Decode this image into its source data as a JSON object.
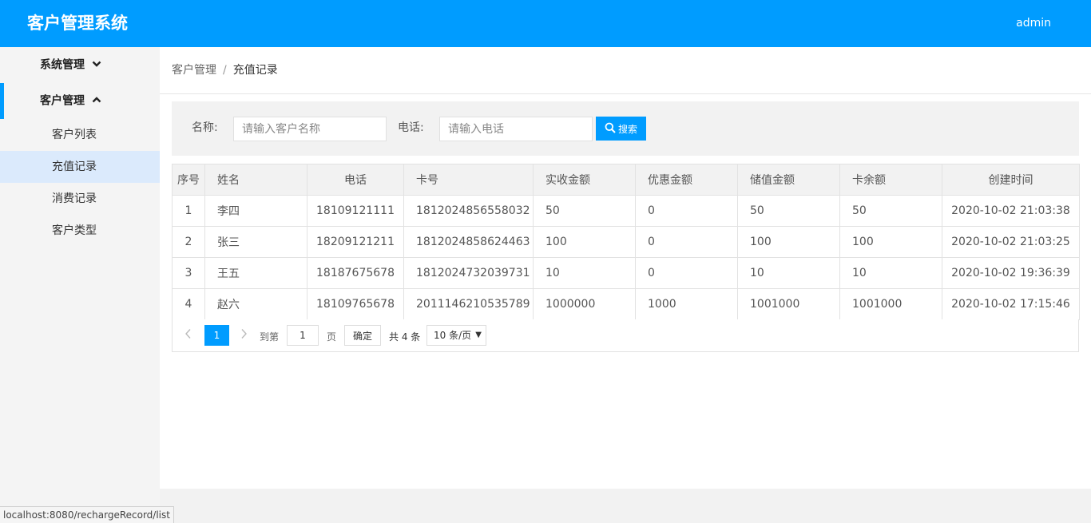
{
  "header": {
    "title": "客户管理系统",
    "user": "admin"
  },
  "sidebar": {
    "group_system": "系统管理",
    "group_customer": "客户管理",
    "items": [
      "客户列表",
      "充值记录",
      "消费记录",
      "客户类型"
    ]
  },
  "breadcrumb": {
    "parent": "客户管理",
    "separator": "/",
    "current": "充值记录"
  },
  "search": {
    "name_label": "名称:",
    "name_placeholder": "请输入客户名称",
    "phone_label": "电话:",
    "phone_placeholder": "请输入电话",
    "button_label": "搜索"
  },
  "table": {
    "headers": [
      "序号",
      "姓名",
      "电话",
      "卡号",
      "实收金额",
      "优惠金额",
      "储值金额",
      "卡余额",
      "创建时间"
    ],
    "rows": [
      [
        "1",
        "李四",
        "18109121111",
        "1812024856558032",
        "50",
        "0",
        "50",
        "50",
        "2020-10-02 21:03:38"
      ],
      [
        "2",
        "张三",
        "18209121211",
        "1812024858624463",
        "100",
        "0",
        "100",
        "100",
        "2020-10-02 21:03:25"
      ],
      [
        "3",
        "王五",
        "18187675678",
        "1812024732039731",
        "10",
        "0",
        "10",
        "10",
        "2020-10-02 19:36:39"
      ],
      [
        "4",
        "赵六",
        "18109765678",
        "2011146210535789",
        "1000000",
        "1000",
        "1001000",
        "1001000",
        "2020-10-02 17:15:46"
      ]
    ]
  },
  "pager": {
    "current": "1",
    "goto_label": "到第",
    "goto_value": "1",
    "page_label": "页",
    "ok_label": "确定",
    "total": "共 4 条",
    "page_size": "10 条/页"
  },
  "status_bar": "localhost:8080/rechargeRecord/list",
  "colors": {
    "brand": "#009cff",
    "selected_nav": "#dbeafc"
  }
}
